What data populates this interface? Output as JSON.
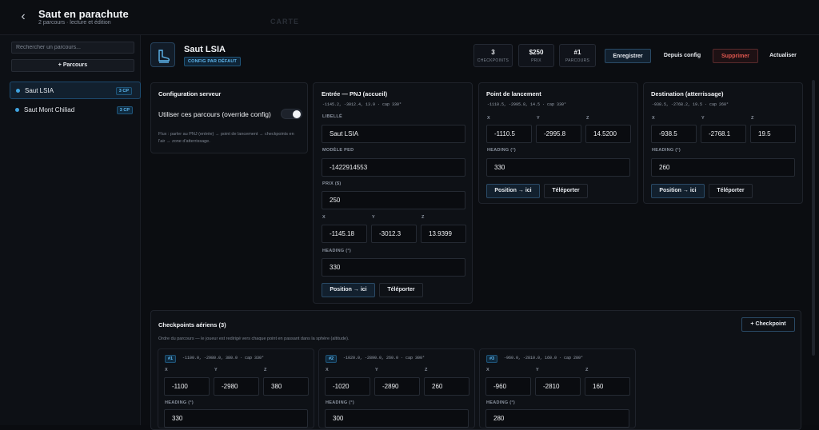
{
  "app": {
    "title": "Saut en parachute",
    "subtitle": "2 parcours · lecture et édition",
    "map_watermark": "CARTE"
  },
  "sidebar": {
    "search_placeholder": "Rechercher un parcours...",
    "add_label": "+ Parcours",
    "items": [
      {
        "label": "Saut LSIA",
        "cp": "3 CP",
        "active": true
      },
      {
        "label": "Saut Mont Chiliad",
        "cp": "3 CP",
        "active": false
      }
    ]
  },
  "header": {
    "title": "Saut LSIA",
    "badge": "CONFIG PAR DÉFAUT",
    "icon": "parachute-boot-icon",
    "stats": [
      {
        "value": "3",
        "label": "CHECKPOINTS"
      },
      {
        "value": "$250",
        "label": "PRIX"
      },
      {
        "value": "#1",
        "label": "PARCOURS"
      }
    ],
    "buttons": {
      "save": "Enregistrer",
      "from_config": "Depuis config",
      "delete": "Supprimer",
      "refresh": "Actualiser"
    }
  },
  "server_config": {
    "title": "Configuration serveur",
    "toggle_label": "Utiliser ces parcours (override config)",
    "toggle_on": true,
    "description": "Flux : parler au PNJ (entrée) → point de lancement → checkpoints en l'air → zone d'atterrissage."
  },
  "entry": {
    "title": "Entrée — PNJ (accueil)",
    "coords": "-1145.2, -3012.4, 13.9 · cap 330°",
    "label_field": "LIBELLÉ",
    "label_value": "Saut LSIA",
    "model_field": "MODÈLE PED",
    "model_value": "-1422914553",
    "price_field": "PRIX ($)",
    "price_value": "250",
    "x_label": "X",
    "y_label": "Y",
    "z_label": "Z",
    "x": "-1145.18",
    "y": "-3012.3",
    "z": "13.9399",
    "heading_label": "HEADING (°)",
    "heading": "330",
    "position_btn": "Position → ici",
    "teleport_btn": "Téléporter"
  },
  "launch": {
    "title": "Point de lancement",
    "coords": "-1110.5, -2995.8, 14.5 · cap 330°",
    "x_label": "X",
    "y_label": "Y",
    "z_label": "Z",
    "x": "-1110.5",
    "y": "-2995.8",
    "z": "14.5200",
    "heading_label": "HEADING (°)",
    "heading": "330",
    "position_btn": "Position → ici",
    "teleport_btn": "Téléporter"
  },
  "destination": {
    "title": "Destination (atterrissage)",
    "coords": "-938.5, -2768.2, 19.5 · cap 260°",
    "x_label": "X",
    "y_label": "Y",
    "z_label": "Z",
    "x": "-938.5",
    "y": "-2768.1",
    "z": "19.5",
    "heading_label": "HEADING (°)",
    "heading": "260",
    "position_btn": "Position → ici",
    "teleport_btn": "Téléporter"
  },
  "checkpoints": {
    "title": "Checkpoints aériens (3)",
    "description": "Ordre du parcours — le joueur est redirigé vers chaque point en passant dans la sphère (altitude).",
    "add_btn": "+ Checkpoint",
    "x_label": "X",
    "y_label": "Y",
    "z_label": "Z",
    "heading_label": "HEADING (°)",
    "items": [
      {
        "badge": "#1",
        "coords": "-1100.0, -2980.0, 380.0 · cap 330°",
        "x": "-1100",
        "y": "-2980",
        "z": "380",
        "heading": "330"
      },
      {
        "badge": "#2",
        "coords": "-1020.0, -2890.0, 260.0 · cap 300°",
        "x": "-1020",
        "y": "-2890",
        "z": "260",
        "heading": "300"
      },
      {
        "badge": "#3",
        "coords": "-960.0, -2810.0, 160.0 · cap 280°",
        "x": "-960",
        "y": "-2810",
        "z": "160",
        "heading": "280"
      }
    ]
  },
  "colors": {
    "accent": "#3fa3e0",
    "danger": "#e0574f",
    "background": "#0b0d11"
  }
}
